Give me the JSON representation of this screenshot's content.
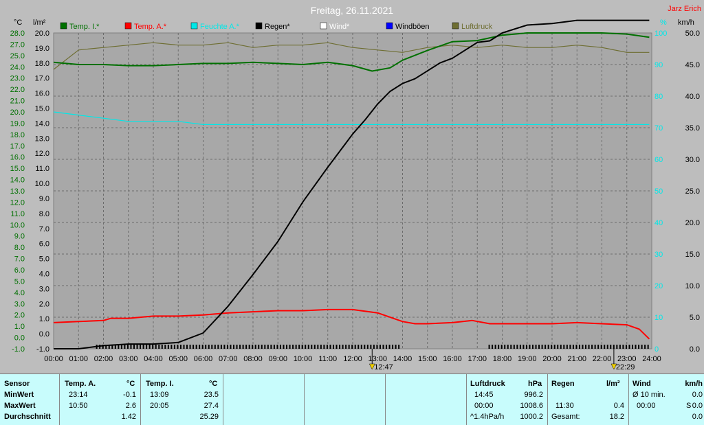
{
  "title": "Freitag, 26.11.2021",
  "author": "Jarz Erich",
  "colors": {
    "temp_in": "#007000",
    "temp_out": "#ff0000",
    "humidity": "#00e8e8",
    "rain": "#000000",
    "wind": "#ffffff",
    "gust": "#0000ff",
    "pressure": "#6e6e32"
  },
  "chart_data": {
    "type": "line",
    "title": "Freitag, 26.11.2021",
    "x_ticks": [
      "00:00",
      "01:00",
      "02:00",
      "03:00",
      "04:00",
      "05:00",
      "06:00",
      "07:00",
      "08:00",
      "09:00",
      "10:00",
      "11:00",
      "12:00",
      "13:00",
      "14:00",
      "15:00",
      "16:00",
      "17:00",
      "18:00",
      "19:00",
      "20:00",
      "21:00",
      "22:00",
      "23:00",
      "24:00"
    ],
    "xlim": [
      0,
      24
    ],
    "axes": {
      "temp": {
        "unit": "°C",
        "ylim": [
          -1.0,
          28.0
        ],
        "ticks": [
          "28.0",
          "27.0",
          "25.0",
          "24.0",
          "23.0",
          "22.0",
          "21.0",
          "20.0",
          "19.0",
          "18.0",
          "17.0",
          "16.0",
          "15.0",
          "14.0",
          "13.0",
          "12.0",
          "11.0",
          "10.0",
          "9.0",
          "8.0",
          "7.0",
          "6.0",
          "5.0",
          "4.0",
          "3.0",
          "2.0",
          "1.0",
          "0.0",
          "-1.0"
        ]
      },
      "rain": {
        "unit": "l/m²",
        "ylim": [
          0,
          20
        ],
        "ticks": [
          "20.0",
          "19.0",
          "18.0",
          "17.0",
          "16.0",
          "15.0",
          "14.0",
          "13.0",
          "12.0",
          "11.0",
          "10.0",
          "9.0",
          "8.0",
          "7.0",
          "6.0",
          "5.0",
          "4.0",
          "3.0",
          "2.0",
          "1.0",
          "0.0",
          "-1.0"
        ]
      },
      "humidity": {
        "unit": "%",
        "ylim": [
          0,
          100
        ],
        "ticks": [
          "100",
          "90",
          "80",
          "70",
          "60",
          "50",
          "40",
          "30",
          "20",
          "10",
          "0"
        ]
      },
      "wind": {
        "unit": "km/h",
        "ylim": [
          0,
          50
        ],
        "ticks": [
          "50.0",
          "45.0",
          "40.0",
          "35.0",
          "30.0",
          "25.0",
          "20.0",
          "15.0",
          "10.0",
          "5.0",
          "0.0"
        ]
      }
    },
    "legend": [
      "Temp. I.*",
      "Temp. A.*",
      "Feuchte A.*",
      "Regen*",
      "Wind*",
      "Windböen",
      "Luftdruck"
    ],
    "series": [
      {
        "name": "Temp. I.*",
        "axis": "temp",
        "color": "#007000",
        "x": [
          0,
          1,
          2,
          3,
          4,
          5,
          6,
          7,
          8,
          9,
          10,
          11,
          12,
          12.78,
          13.5,
          14,
          15,
          16,
          17,
          18,
          19,
          20,
          21,
          22,
          23,
          23.9
        ],
        "y": [
          25.3,
          25.1,
          25.1,
          25.0,
          25.0,
          25.1,
          25.2,
          25.2,
          25.3,
          25.2,
          25.1,
          25.3,
          25.0,
          24.5,
          24.8,
          25.5,
          26.4,
          27.2,
          27.3,
          27.8,
          28.0,
          28.0,
          28.0,
          28.0,
          27.9,
          27.6
        ]
      },
      {
        "name": "Temp. A.*",
        "axis": "temp",
        "color": "#ff0000",
        "x": [
          0,
          1,
          2,
          2.3,
          3,
          4,
          5,
          6,
          7,
          8,
          9,
          10,
          11,
          12,
          13,
          14,
          14.5,
          15,
          16,
          16.8,
          17.5,
          18,
          19,
          20,
          21,
          22,
          23,
          23.5,
          23.9
        ],
        "y": [
          1.4,
          1.5,
          1.6,
          1.8,
          1.8,
          2.0,
          2.0,
          2.1,
          2.3,
          2.4,
          2.5,
          2.5,
          2.6,
          2.6,
          2.3,
          1.5,
          1.3,
          1.3,
          1.4,
          1.6,
          1.3,
          1.3,
          1.3,
          1.3,
          1.4,
          1.3,
          1.2,
          0.8,
          -0.1
        ]
      },
      {
        "name": "Feuchte A.*",
        "axis": "humidity",
        "color": "#00e8e8",
        "x": [
          0,
          1,
          2,
          3,
          4,
          5,
          6,
          7,
          8,
          9,
          10,
          11,
          12,
          13,
          14,
          15,
          16,
          17,
          18,
          19,
          20,
          21,
          22,
          23,
          23.9
        ],
        "y": [
          75,
          74,
          73,
          72,
          72,
          72,
          71,
          71,
          71,
          71,
          71,
          71,
          71,
          71,
          71,
          71,
          71,
          71,
          71,
          71,
          71,
          71,
          71,
          71,
          71
        ]
      },
      {
        "name": "Regen*",
        "axis": "rain",
        "color": "#000000",
        "x": [
          0,
          1,
          2,
          3,
          4,
          5,
          6,
          7,
          8,
          9,
          10,
          11,
          12,
          12.5,
          13,
          13.5,
          14,
          14.5,
          15,
          15.5,
          16,
          17,
          17.5,
          18,
          19,
          20,
          21,
          22,
          23,
          23.9
        ],
        "y": [
          0,
          0,
          0.2,
          0.3,
          0.3,
          0.4,
          1.0,
          2.7,
          4.7,
          6.8,
          9.3,
          11.5,
          13.6,
          14.5,
          15.5,
          16.3,
          16.8,
          17.1,
          17.6,
          18.1,
          18.4,
          19.4,
          19.5,
          20.0,
          20.5,
          20.6,
          20.8,
          20.8,
          20.8,
          20.8
        ]
      },
      {
        "name": "Luftdruck",
        "axis": "pressure",
        "color": "#6e6e32",
        "ylim": [
          996,
          1009
        ],
        "x": [
          0,
          1,
          2,
          3,
          4,
          5,
          6,
          7,
          8,
          9,
          10,
          11,
          12,
          13,
          14,
          15,
          16,
          17,
          18,
          19,
          20,
          21,
          22,
          23,
          23.9
        ],
        "y": [
          1007.5,
          1008.3,
          1008.4,
          1008.5,
          1008.6,
          1008.5,
          1008.5,
          1008.6,
          1008.4,
          1008.5,
          1008.5,
          1008.6,
          1008.4,
          1008.3,
          1008.2,
          1008.4,
          1008.5,
          1008.4,
          1008.5,
          1008.4,
          1008.4,
          1008.5,
          1008.4,
          1008.2,
          1008.2
        ]
      }
    ],
    "markers": [
      {
        "x": 12.78,
        "label": "12:47"
      },
      {
        "x": 22.48,
        "label": "22:29"
      }
    ]
  },
  "panel": {
    "sensor": {
      "header": "Sensor",
      "rows": [
        "MinWert",
        "MaxWert",
        "Durchschnitt"
      ]
    },
    "temp_a": {
      "header": "Temp. A.",
      "unit": "°C",
      "times": [
        "23:14",
        "10:50",
        ""
      ],
      "values": [
        "-0.1",
        "2.6",
        "1.42"
      ]
    },
    "temp_i": {
      "header": "Temp. I.",
      "unit": "°C",
      "times": [
        "13:09",
        "20:05",
        ""
      ],
      "values": [
        "23.5",
        "27.4",
        "25.29"
      ]
    },
    "pressure": {
      "header": "Luftdruck",
      "unit": "hPa",
      "times": [
        "14:45",
        "00:00",
        "^1.4hPa/h"
      ],
      "values": [
        "996.2",
        "1008.6",
        "1000.2"
      ]
    },
    "rain": {
      "header": "Regen",
      "unit": "l/m²",
      "times": [
        "",
        "11:30",
        "Gesamt:"
      ],
      "values": [
        "",
        "0.4",
        "18.2"
      ]
    },
    "wind": {
      "header": "Wind",
      "unit": "km/h",
      "times": [
        "Ø 10 min.",
        "00:00",
        ""
      ],
      "mid": [
        "",
        "S",
        ""
      ],
      "values": [
        "0.0",
        "0.0",
        "0.0"
      ]
    }
  }
}
